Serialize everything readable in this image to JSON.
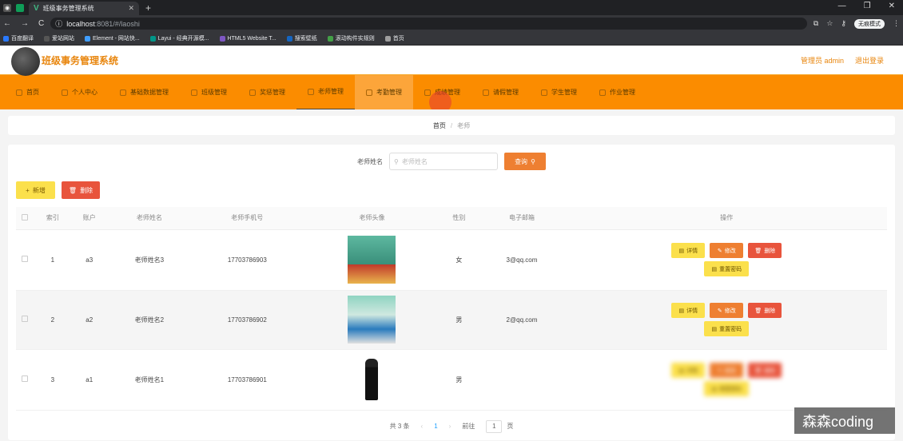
{
  "browser": {
    "tab_title": "班级事务管理系统",
    "new_tab": "+",
    "url_host": "localhost",
    "url_rest": ":8081/#/laoshi",
    "profile": "无痕模式",
    "bookmarks": [
      {
        "label": "百度翻译",
        "color": "#2979ff"
      },
      {
        "label": "爱站网站",
        "color": "#555"
      },
      {
        "label": "Element - 网站快...",
        "color": "#409eff"
      },
      {
        "label": "Layui - 经典开源模...",
        "color": "#009688"
      },
      {
        "label": "HTML5 Website T...",
        "color": "#7e57c2"
      },
      {
        "label": "搜索壁纸",
        "color": "#1565c0"
      },
      {
        "label": "滚动构件实规则",
        "color": "#43a047"
      },
      {
        "label": "首页",
        "color": "#9e9e9e"
      }
    ]
  },
  "header": {
    "title": "班级事务管理系统",
    "admin_label": "管理员 admin",
    "logout_label": "退出登录"
  },
  "menu": {
    "items": [
      {
        "label": "首页"
      },
      {
        "label": "个人中心"
      },
      {
        "label": "基础数据管理"
      },
      {
        "label": "班级管理"
      },
      {
        "label": "奖惩管理"
      },
      {
        "label": "老师管理"
      },
      {
        "label": "考勤管理"
      },
      {
        "label": "成绩管理"
      },
      {
        "label": "请假管理"
      },
      {
        "label": "学生管理"
      },
      {
        "label": "作业管理"
      }
    ],
    "active_index": 5,
    "hover_index": 6
  },
  "breadcrumb": {
    "home": "首页",
    "sep": "/",
    "current": "老师"
  },
  "search": {
    "label": "老师姓名",
    "placeholder": "老师姓名",
    "button": "查询"
  },
  "actions": {
    "add": "新增",
    "delete": "删除"
  },
  "table": {
    "headers": [
      "索引",
      "账户",
      "老师姓名",
      "老师手机号",
      "老师头像",
      "性别",
      "电子邮箱",
      "操作"
    ],
    "rows": [
      {
        "index": "1",
        "account": "a3",
        "name": "老师姓名3",
        "phone": "17703786903",
        "gender": "女",
        "email": "3@qq.com"
      },
      {
        "index": "2",
        "account": "a2",
        "name": "老师姓名2",
        "phone": "17703786902",
        "gender": "男",
        "email": "2@qq.com"
      },
      {
        "index": "3",
        "account": "a1",
        "name": "老师姓名1",
        "phone": "17703786901",
        "gender": "男",
        "email": ""
      }
    ],
    "op_labels": {
      "detail": "详情",
      "edit": "修改",
      "delete": "删除",
      "reset": "重置密码"
    }
  },
  "pager": {
    "total": "共 3 条",
    "prev": "‹",
    "page": "1",
    "next": "›",
    "goto": "前往",
    "goto_value": "1",
    "unit": "页"
  },
  "watermark": "森森coding",
  "colors": {
    "menu_bg": "#fb8c00",
    "accent": "#e8850c",
    "query": "#ee7f31",
    "danger": "#e8543c",
    "warning": "#fbe04c"
  }
}
